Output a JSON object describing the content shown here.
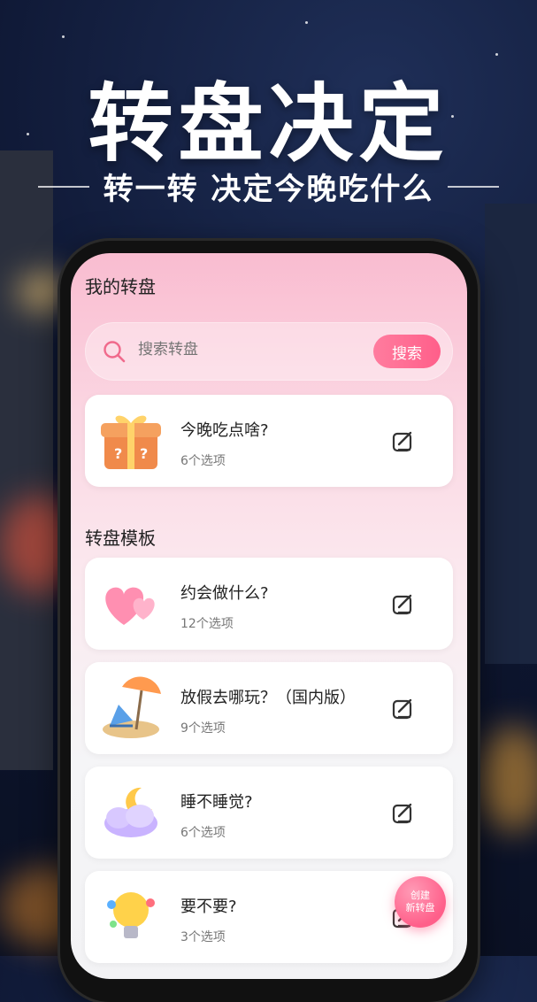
{
  "hero": {
    "title": "转盘决定",
    "subtitle": "转一转 决定今晚吃什么"
  },
  "app": {
    "my_section_title": "我的转盘",
    "search": {
      "placeholder": "搜索转盘",
      "button_label": "搜索"
    },
    "my_wheels": [
      {
        "title": "今晚吃点啥?",
        "options": "6个选项",
        "icon": "gift-box-icon"
      }
    ],
    "template_section_title": "转盘模板",
    "templates": [
      {
        "title": "约会做什么?",
        "options": "12个选项",
        "icon": "hearts-icon"
      },
      {
        "title": "放假去哪玩？（国内版）",
        "options": "9个选项",
        "icon": "beach-chair-icon"
      },
      {
        "title": "睡不睡觉?",
        "options": "6个选项",
        "icon": "moon-cloud-icon"
      },
      {
        "title": "要不要?",
        "options": "3个选项",
        "icon": "lightbulb-icon"
      }
    ],
    "fab": {
      "line1": "创建",
      "line2": "新转盘"
    }
  },
  "colors": {
    "accent": "#ff5f8a",
    "background": "#0e1733"
  }
}
